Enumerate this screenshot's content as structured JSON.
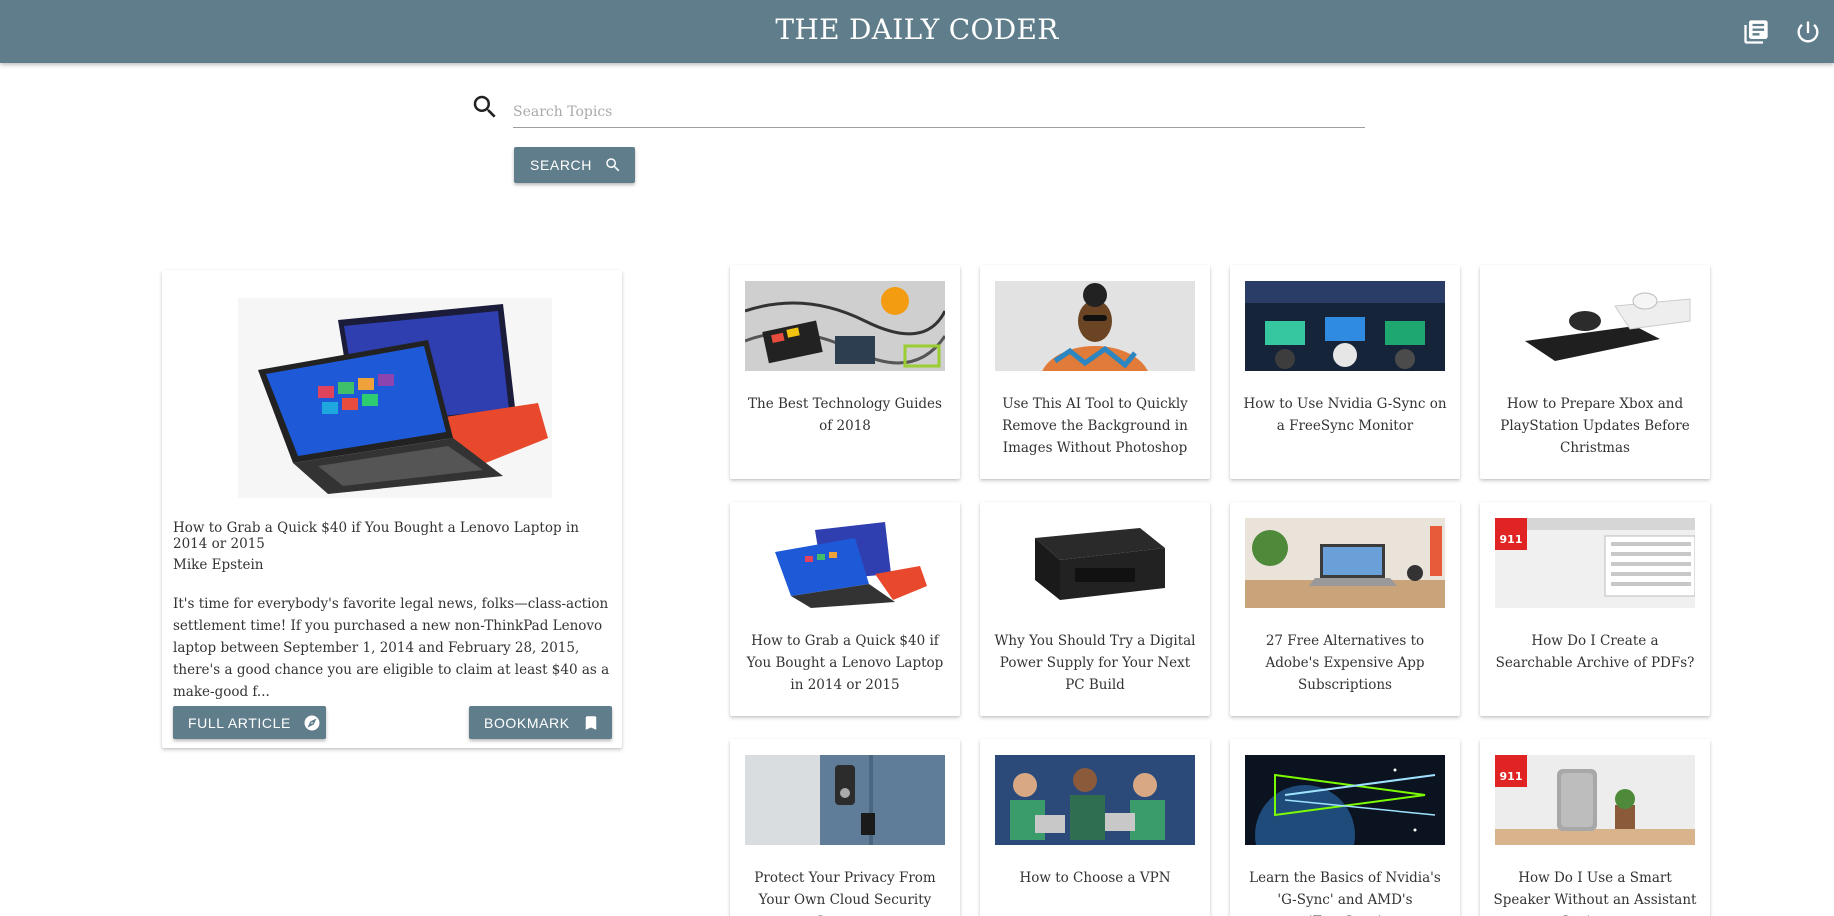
{
  "app": {
    "title": "THE DAILY CODER"
  },
  "header_icons": [
    "library-books-icon",
    "power-icon"
  ],
  "search": {
    "placeholder": "Search Topics",
    "value": "",
    "button_label": "SEARCH"
  },
  "colors": {
    "primary": "#607d8b",
    "text": "#333333",
    "background": "#ffffff"
  },
  "featured": {
    "title": "How to Grab a Quick $40 if You Bought a Lenovo Laptop in 2014 or 2015",
    "author": "Mike Epstein",
    "summary": "It's time for everybody's favorite legal news, folks—class-action settlement time! If you purchased a new non-ThinkPad Lenovo laptop between September 1, 2014 and February 28, 2015, there's a good chance you are eligible to claim at least $40 as a make-good f...",
    "full_article_label": "FULL ARTICLE",
    "bookmark_label": "BOOKMARK"
  },
  "articles": [
    {
      "title": "The Best Technology Guides of 2018"
    },
    {
      "title": "Use This AI Tool to Quickly Remove the Background in Images Without Photoshop"
    },
    {
      "title": "How to Use Nvidia G-Sync on a FreeSync Monitor"
    },
    {
      "title": "How to Prepare Xbox and PlayStation Updates Before Christmas"
    },
    {
      "title": "How to Grab a Quick $40 if You Bought a Lenovo Laptop in 2014 or 2015"
    },
    {
      "title": "Why You Should Try a Digital Power Supply for Your Next PC Build"
    },
    {
      "title": "27 Free Alternatives to Adobe's Expensive App Subscriptions"
    },
    {
      "title": "How Do I Create a Searchable Archive of PDFs?"
    },
    {
      "title": "Protect Your Privacy From Your Own Cloud Security Cameras"
    },
    {
      "title": "How to Choose a VPN"
    },
    {
      "title": "Learn the Basics of Nvidia's 'G-Sync' and AMD's 'FreeSync'"
    },
    {
      "title": "How Do I Use a Smart Speaker Without an Assistant Spying on"
    }
  ],
  "badge_text": "911"
}
